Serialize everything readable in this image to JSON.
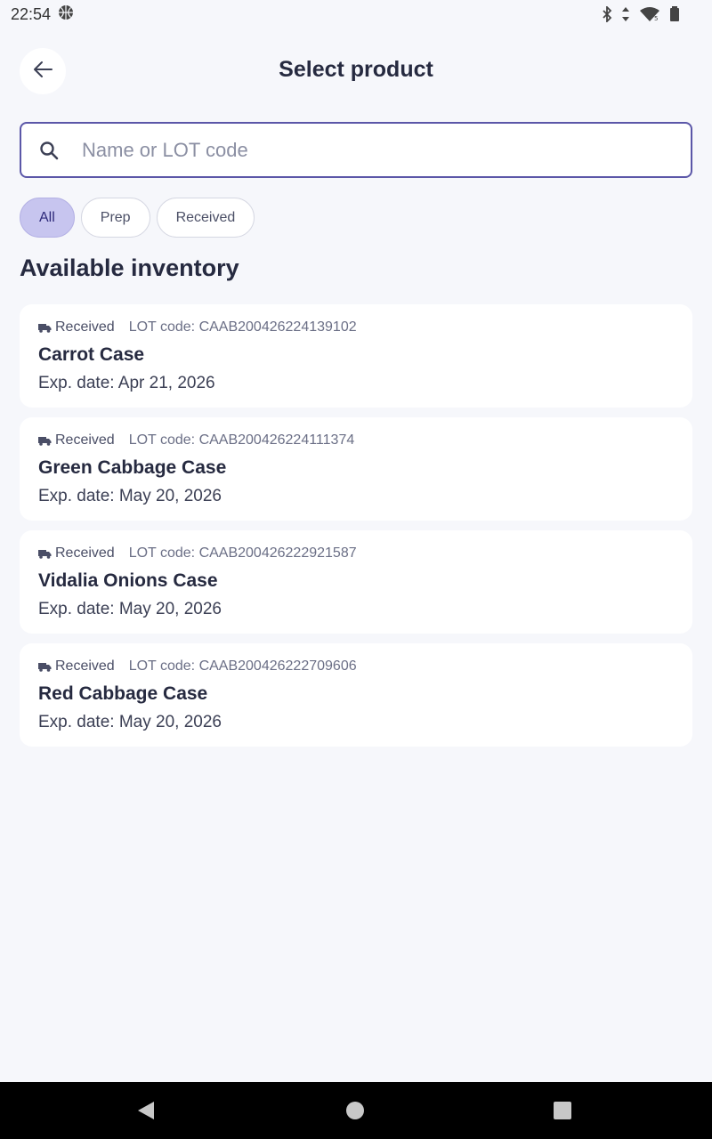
{
  "status_bar": {
    "time": "22:54"
  },
  "header": {
    "title": "Select product"
  },
  "search": {
    "placeholder": "Name or LOT code",
    "value": ""
  },
  "filters": [
    {
      "label": "All",
      "active": true
    },
    {
      "label": "Prep",
      "active": false
    },
    {
      "label": "Received",
      "active": false
    }
  ],
  "section_title": "Available inventory",
  "products": [
    {
      "status": "Received",
      "lot": "LOT code: CAAB200426224139102",
      "name": "Carrot Case",
      "exp": "Exp. date: Apr 21, 2026"
    },
    {
      "status": "Received",
      "lot": "LOT code: CAAB200426224111374",
      "name": "Green Cabbage Case",
      "exp": "Exp. date: May 20, 2026"
    },
    {
      "status": "Received",
      "lot": "LOT code: CAAB200426222921587",
      "name": "Vidalia Onions Case",
      "exp": "Exp. date: May 20, 2026"
    },
    {
      "status": "Received",
      "lot": "LOT code: CAAB200426222709606",
      "name": "Red Cabbage Case",
      "exp": "Exp. date: May 20, 2026"
    }
  ],
  "icons": {
    "back": "arrow-left-icon",
    "search": "magnifier-icon",
    "status_type": "truck-icon"
  },
  "colors": {
    "accent": "#5b57a8",
    "chip_active": "#c7c5ef",
    "background": "#f6f7fb",
    "text": "#262a40"
  }
}
